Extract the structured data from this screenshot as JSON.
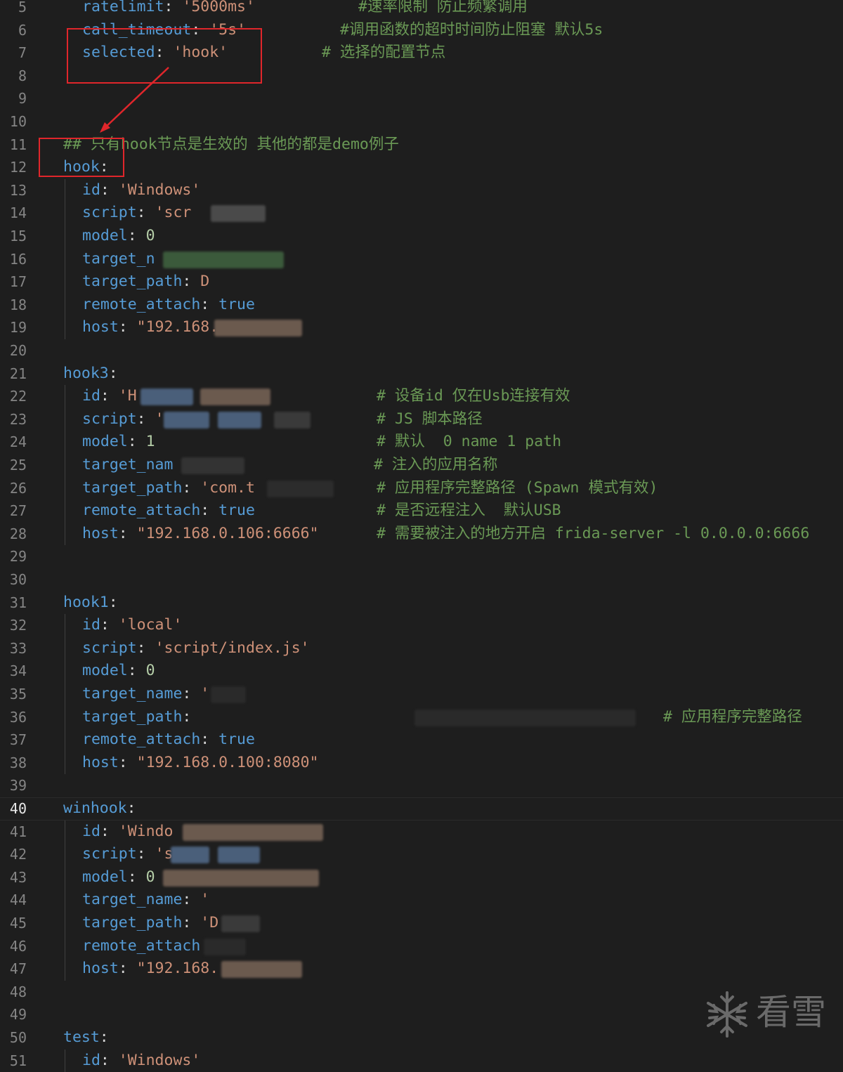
{
  "editor": {
    "language": "yaml",
    "theme": "dark",
    "current_line": 40,
    "lines": [
      {
        "n": "5",
        "indent": 1,
        "key": "ratelimit",
        "value": "'5000ms'",
        "vtype": "str",
        "comment": "#速率限制 防止频繁调用"
      },
      {
        "n": "6",
        "indent": 1,
        "key": "call_timeout",
        "value": "'5s'",
        "vtype": "str",
        "comment": "#调用函数的超时时间防止阻塞 默认5s"
      },
      {
        "n": "7",
        "indent": 1,
        "key": "selected",
        "value": "'hook'",
        "vtype": "str",
        "comment": "# 选择的配置节点"
      },
      {
        "n": "8",
        "indent": 0
      },
      {
        "n": "9",
        "indent": 0
      },
      {
        "n": "10",
        "indent": 0
      },
      {
        "n": "11",
        "indent": 0,
        "comment": "## 只有hook节点是生效的 其他的都是demo例子",
        "comment_only": true
      },
      {
        "n": "12",
        "indent": 0,
        "key": "hook"
      },
      {
        "n": "13",
        "indent": 1,
        "key": "id",
        "value": "'Windows'",
        "vtype": "str"
      },
      {
        "n": "14",
        "indent": 1,
        "key": "script",
        "value": "'scr",
        "vtype": "str"
      },
      {
        "n": "15",
        "indent": 1,
        "key": "model",
        "value": "0",
        "vtype": "num"
      },
      {
        "n": "16",
        "indent": 1,
        "key": "target_n",
        "partial": true
      },
      {
        "n": "17",
        "indent": 1,
        "key": "target_path",
        "value": "D",
        "vtype": "str"
      },
      {
        "n": "18",
        "indent": 1,
        "key": "remote_attach",
        "value": "true",
        "vtype": "bool"
      },
      {
        "n": "19",
        "indent": 1,
        "key": "host",
        "value": "\"192.168.",
        "vtype": "str"
      },
      {
        "n": "20",
        "indent": 0
      },
      {
        "n": "21",
        "indent": 0,
        "key": "hook3"
      },
      {
        "n": "22",
        "indent": 1,
        "key": "id",
        "value": "'H",
        "vtype": "str",
        "comment": "# 设备id 仅在Usb连接有效"
      },
      {
        "n": "23",
        "indent": 1,
        "key": "script",
        "value": "'",
        "vtype": "str",
        "comment": "# JS 脚本路径"
      },
      {
        "n": "24",
        "indent": 1,
        "key": "model",
        "value": "1",
        "vtype": "num",
        "comment": "# 默认  0 name 1 path"
      },
      {
        "n": "25",
        "indent": 1,
        "key": "target_nam",
        "partial": true,
        "comment": "# 注入的应用名称"
      },
      {
        "n": "26",
        "indent": 1,
        "key": "target_path",
        "value": "'com.t",
        "vtype": "str",
        "comment": "# 应用程序完整路径 (Spawn 模式有效)"
      },
      {
        "n": "27",
        "indent": 1,
        "key": "remote_attach",
        "value": "true",
        "vtype": "bool",
        "comment": "# 是否远程注入  默认USB"
      },
      {
        "n": "28",
        "indent": 1,
        "key": "host",
        "value": "\"192.168.0.106:6666\"",
        "vtype": "str",
        "comment": "# 需要被注入的地方开启 frida-server -l 0.0.0.0:6666"
      },
      {
        "n": "29",
        "indent": 0
      },
      {
        "n": "30",
        "indent": 0
      },
      {
        "n": "31",
        "indent": 0,
        "key": "hook1"
      },
      {
        "n": "32",
        "indent": 1,
        "key": "id",
        "value": "'local'",
        "vtype": "str"
      },
      {
        "n": "33",
        "indent": 1,
        "key": "script",
        "value": "'script/index.js'",
        "vtype": "str"
      },
      {
        "n": "34",
        "indent": 1,
        "key": "model",
        "value": "0",
        "vtype": "num"
      },
      {
        "n": "35",
        "indent": 1,
        "key": "target_name",
        "value": "'",
        "vtype": "str"
      },
      {
        "n": "36",
        "indent": 1,
        "key": "target_path",
        "value": "",
        "vtype": "str",
        "comment": "# 应用程序完整路径"
      },
      {
        "n": "37",
        "indent": 1,
        "key": "remote_attach",
        "value": "true",
        "vtype": "bool"
      },
      {
        "n": "38",
        "indent": 1,
        "key": "host",
        "value": "\"192.168.0.100:8080\"",
        "vtype": "str"
      },
      {
        "n": "39",
        "indent": 0
      },
      {
        "n": "40",
        "indent": 0,
        "key": "winhook"
      },
      {
        "n": "41",
        "indent": 1,
        "key": "id",
        "value": "'Windo",
        "vtype": "str"
      },
      {
        "n": "42",
        "indent": 1,
        "key": "script",
        "value": "'s",
        "vtype": "str"
      },
      {
        "n": "43",
        "indent": 1,
        "key": "model",
        "value": "0",
        "vtype": "num"
      },
      {
        "n": "44",
        "indent": 1,
        "key": "target_name",
        "value": "'",
        "vtype": "str"
      },
      {
        "n": "45",
        "indent": 1,
        "key": "target_path",
        "value": "'D",
        "vtype": "str"
      },
      {
        "n": "46",
        "indent": 1,
        "key": "remote_attach",
        "partial": true
      },
      {
        "n": "47",
        "indent": 1,
        "key": "host",
        "value": "\"192.168.",
        "vtype": "str"
      },
      {
        "n": "48",
        "indent": 0
      },
      {
        "n": "49",
        "indent": 0
      },
      {
        "n": "50",
        "indent": 0,
        "key": "test"
      },
      {
        "n": "51",
        "indent": 1,
        "key": "id",
        "value": "'Windows'",
        "vtype": "str"
      }
    ]
  },
  "watermark": {
    "text": "看雪",
    "icon": "snowflake-icon"
  },
  "colors": {
    "background": "#1e1e1e",
    "key": "#569cd6",
    "string": "#ce9178",
    "number": "#b5cea8",
    "comment": "#6a9955",
    "annotation": "#e0262b"
  }
}
